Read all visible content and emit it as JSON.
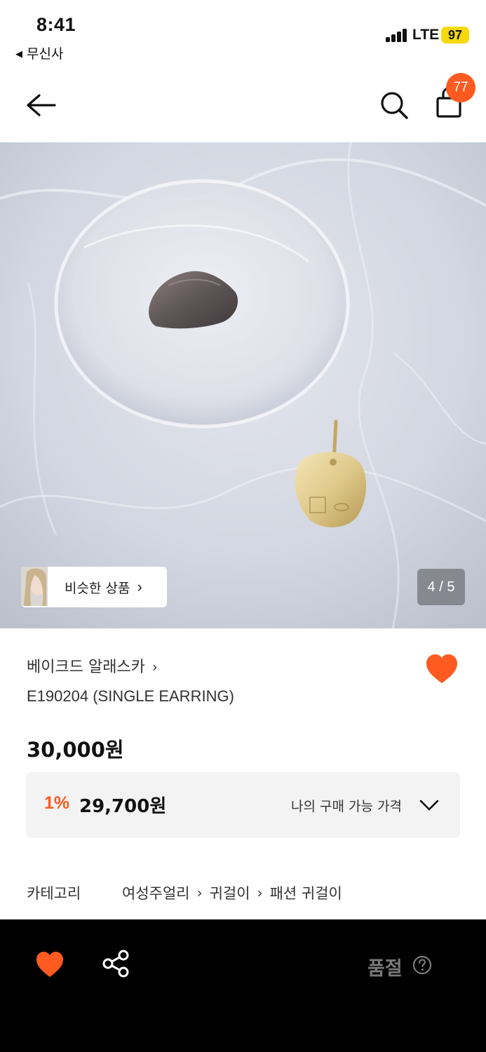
{
  "status_bar": {
    "time": "8:41",
    "back_app": "무신사",
    "network": "LTE",
    "battery": "97"
  },
  "nav": {
    "cart_count": "77"
  },
  "gallery": {
    "similar_label": "비슷한 상품",
    "page_counter": "4 / 5"
  },
  "product": {
    "brand": "베이크드 알래스카",
    "title": "E190204 (SINGLE EARRING)",
    "price": "30,000원",
    "discount_rate": "1%",
    "discount_price": "29,700원",
    "my_price_label": "나의 구매 가능 가격",
    "wishlisted": true
  },
  "category": {
    "label": "카테고리",
    "path": [
      "여성주얼리",
      "귀걸이",
      "패션 귀걸이"
    ]
  },
  "bottom_bar": {
    "soldout_label": "품절"
  },
  "colors": {
    "accent": "#ff5a1f",
    "badge_battery": "#f5d90b",
    "bottom_bar_bg": "#000000"
  },
  "icons": [
    "back-arrow-icon",
    "search-icon",
    "shopping-bag-icon",
    "heart-icon",
    "share-icon",
    "help-circle-icon",
    "chevron-right-icon",
    "chevron-down-icon"
  ]
}
